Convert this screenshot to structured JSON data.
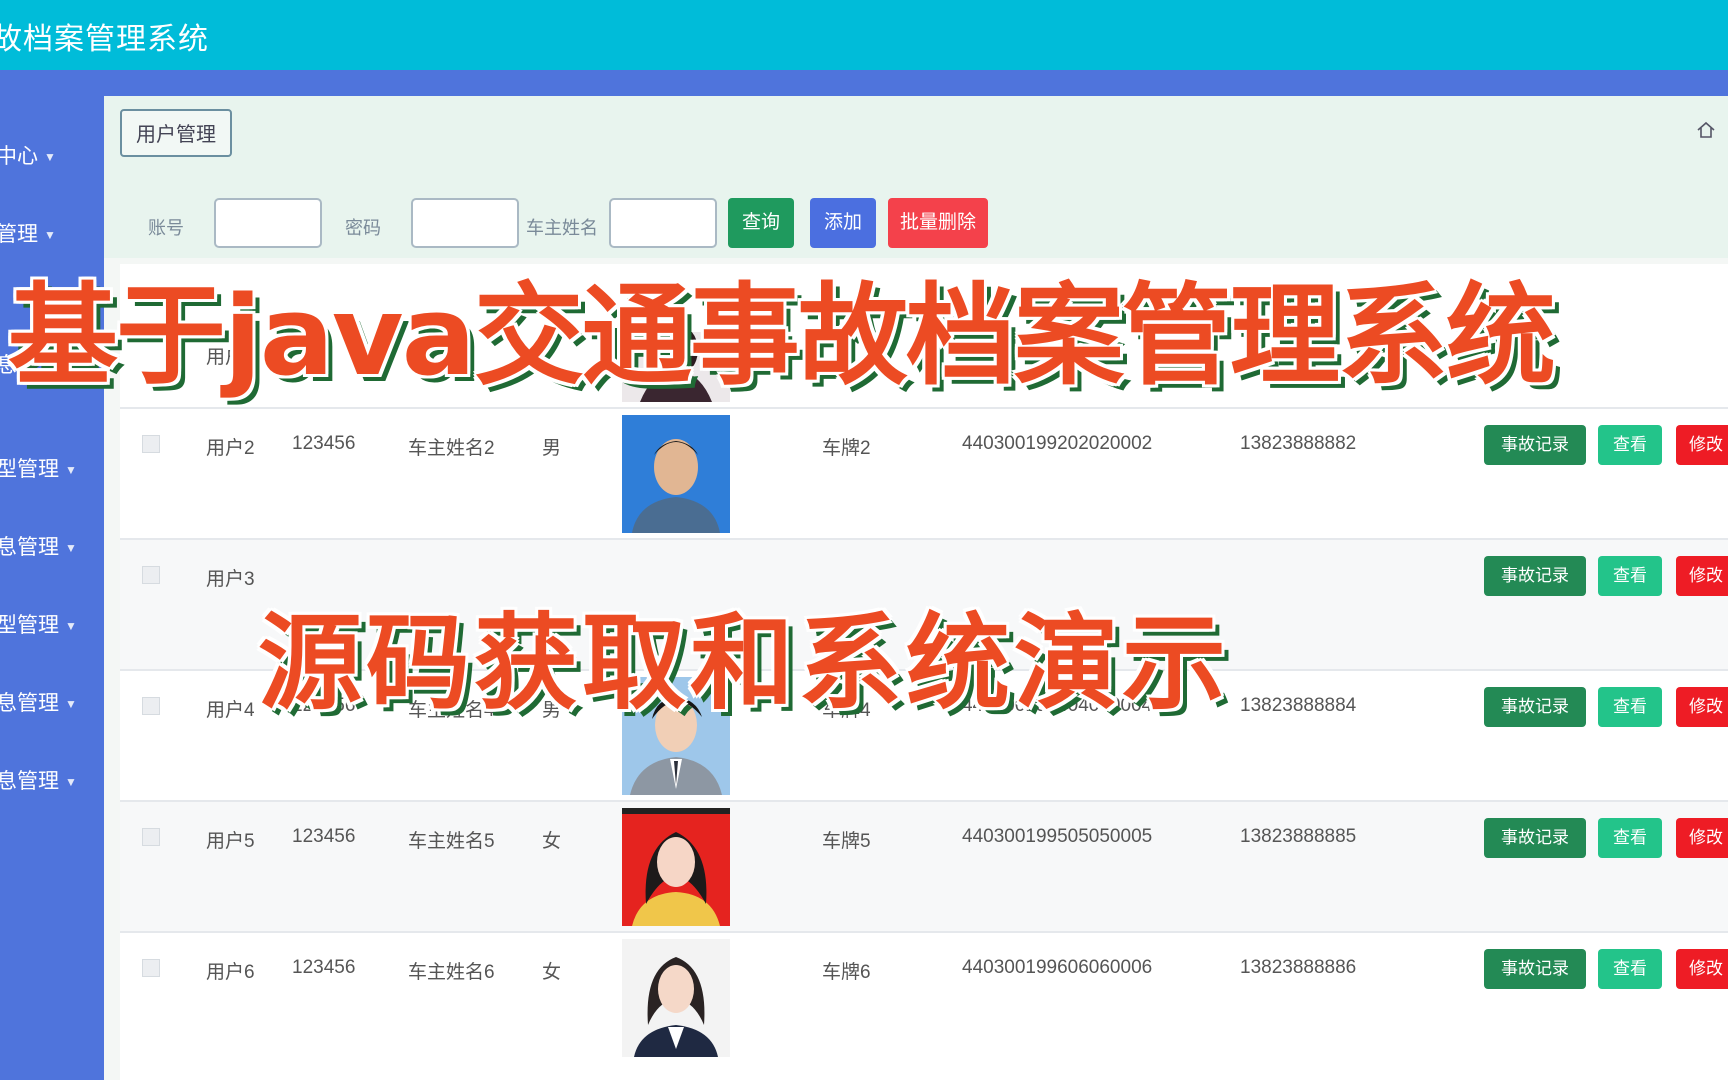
{
  "app": {
    "title": "故档案管理系统"
  },
  "sidebar": {
    "items": [
      {
        "label": "中心"
      },
      {
        "label": "管理"
      },
      {
        "label": "息管理"
      },
      {
        "label": "型管理"
      },
      {
        "label": "息管理"
      },
      {
        "label": "型管理"
      },
      {
        "label": "息管理"
      },
      {
        "label": "息管理"
      }
    ]
  },
  "breadcrumb": {
    "label": "用户管理"
  },
  "search": {
    "account_label": "账号",
    "password_label": "密码",
    "owner_label": "车主姓名",
    "query_button": "查询",
    "add_button": "添加",
    "batch_delete_button": "批量删除"
  },
  "table": {
    "rows": [
      {
        "account": "用户1",
        "password": "",
        "owner": "",
        "gender": "",
        "plate": "",
        "id_no": "",
        "phone": "",
        "photo": "female-dark"
      },
      {
        "account": "用户2",
        "password": "123456",
        "owner": "车主姓名2",
        "gender": "男",
        "plate": "车牌2",
        "id_no": "440300199202020002",
        "phone": "13823888882",
        "photo": "male-blue"
      },
      {
        "account": "用户3",
        "password": "",
        "owner": "",
        "gender": "",
        "plate": "",
        "id_no": "",
        "phone": "",
        "photo": "hidden"
      },
      {
        "account": "用户4",
        "password": "123456",
        "owner": "车主姓名4",
        "gender": "男",
        "plate": "车牌4",
        "id_no": "440300199404040004",
        "phone": "13823888884",
        "photo": "male-lightblue"
      },
      {
        "account": "用户5",
        "password": "123456",
        "owner": "车主姓名5",
        "gender": "女",
        "plate": "车牌5",
        "id_no": "440300199505050005",
        "phone": "13823888885",
        "photo": "female-red"
      },
      {
        "account": "用户6",
        "password": "123456",
        "owner": "车主姓名6",
        "gender": "女",
        "plate": "车牌6",
        "id_no": "440300199606060006",
        "phone": "13823888886",
        "photo": "female-white"
      }
    ],
    "actions": {
      "record": "事故记录",
      "view": "查看",
      "edit": "修改"
    }
  },
  "overlay": {
    "headline": "基于java交通事故档案管理系统",
    "subheadline": "源码获取和系统演示"
  },
  "colors": {
    "topbar": "#00bcd9",
    "sidebar": "#4f74dc",
    "query": "#1f9a5e",
    "add": "#4b6fe0",
    "batch_delete": "#f4414b",
    "record": "#238a55",
    "view": "#23c48a",
    "edit": "#ee1c25",
    "overlay_text": "#ec4b23"
  }
}
